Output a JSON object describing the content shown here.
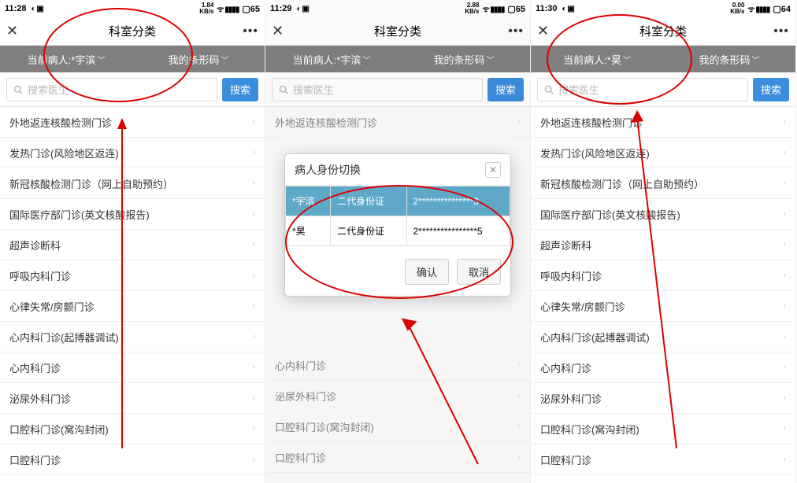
{
  "screens": [
    {
      "status": {
        "time": "11:28",
        "kbs": "1.84",
        "battery": "65"
      },
      "title": "科室分类",
      "tabs": {
        "patient_label": "当前病人:*宇滨",
        "barcode_label": "我的条形码"
      },
      "search": {
        "placeholder": "搜索医生",
        "btn": "搜索"
      },
      "list": [
        "外地返连核酸检测门诊",
        "发热门诊(风险地区返连)",
        "新冠核酸检测门诊（网上自助预约）",
        "国际医疗部门诊(英文核酸报告)",
        "超声诊断科",
        "呼吸内科门诊",
        "心律失常/房颤门诊",
        "心内科门诊(起搏器调试)",
        "心内科门诊",
        "泌尿外科门诊",
        "口腔科门诊(窝沟封闭)",
        "口腔科门诊"
      ]
    },
    {
      "status": {
        "time": "11:29",
        "kbs": "2.88",
        "battery": "65"
      },
      "title": "科室分类",
      "tabs": {
        "patient_label": "当前病人:*宇滨",
        "barcode_label": "我的条形码"
      },
      "search": {
        "placeholder": "搜索医生",
        "btn": "搜索"
      },
      "list_partial": [
        "外地返连核酸检测门诊",
        "心内科门诊",
        "泌尿外科门诊",
        "口腔科门诊(窝沟封闭)",
        "口腔科门诊"
      ],
      "dialog": {
        "title": "病人身份切换",
        "rows": [
          {
            "name": "*宇滨",
            "type": "二代身份证",
            "id": "2***************3"
          },
          {
            "name": "*昊",
            "type": "二代身份证",
            "id": "2****************5"
          }
        ],
        "ok": "确认",
        "cancel": "取消"
      }
    },
    {
      "status": {
        "time": "11:30",
        "kbs": "0.00",
        "battery": "64"
      },
      "title": "科室分类",
      "tabs": {
        "patient_label": "当前病人:*昊",
        "barcode_label": "我的条形码"
      },
      "search": {
        "placeholder": "搜索医生",
        "btn": "搜索"
      },
      "list": [
        "外地返连核酸检测门诊",
        "发热门诊(风险地区返连)",
        "新冠核酸检测门诊（网上自助预约）",
        "国际医疗部门诊(英文核酸报告)",
        "超声诊断科",
        "呼吸内科门诊",
        "心律失常/房颤门诊",
        "心内科门诊(起搏器调试)",
        "心内科门诊",
        "泌尿外科门诊",
        "口腔科门诊(窝沟封闭)",
        "口腔科门诊"
      ]
    }
  ]
}
